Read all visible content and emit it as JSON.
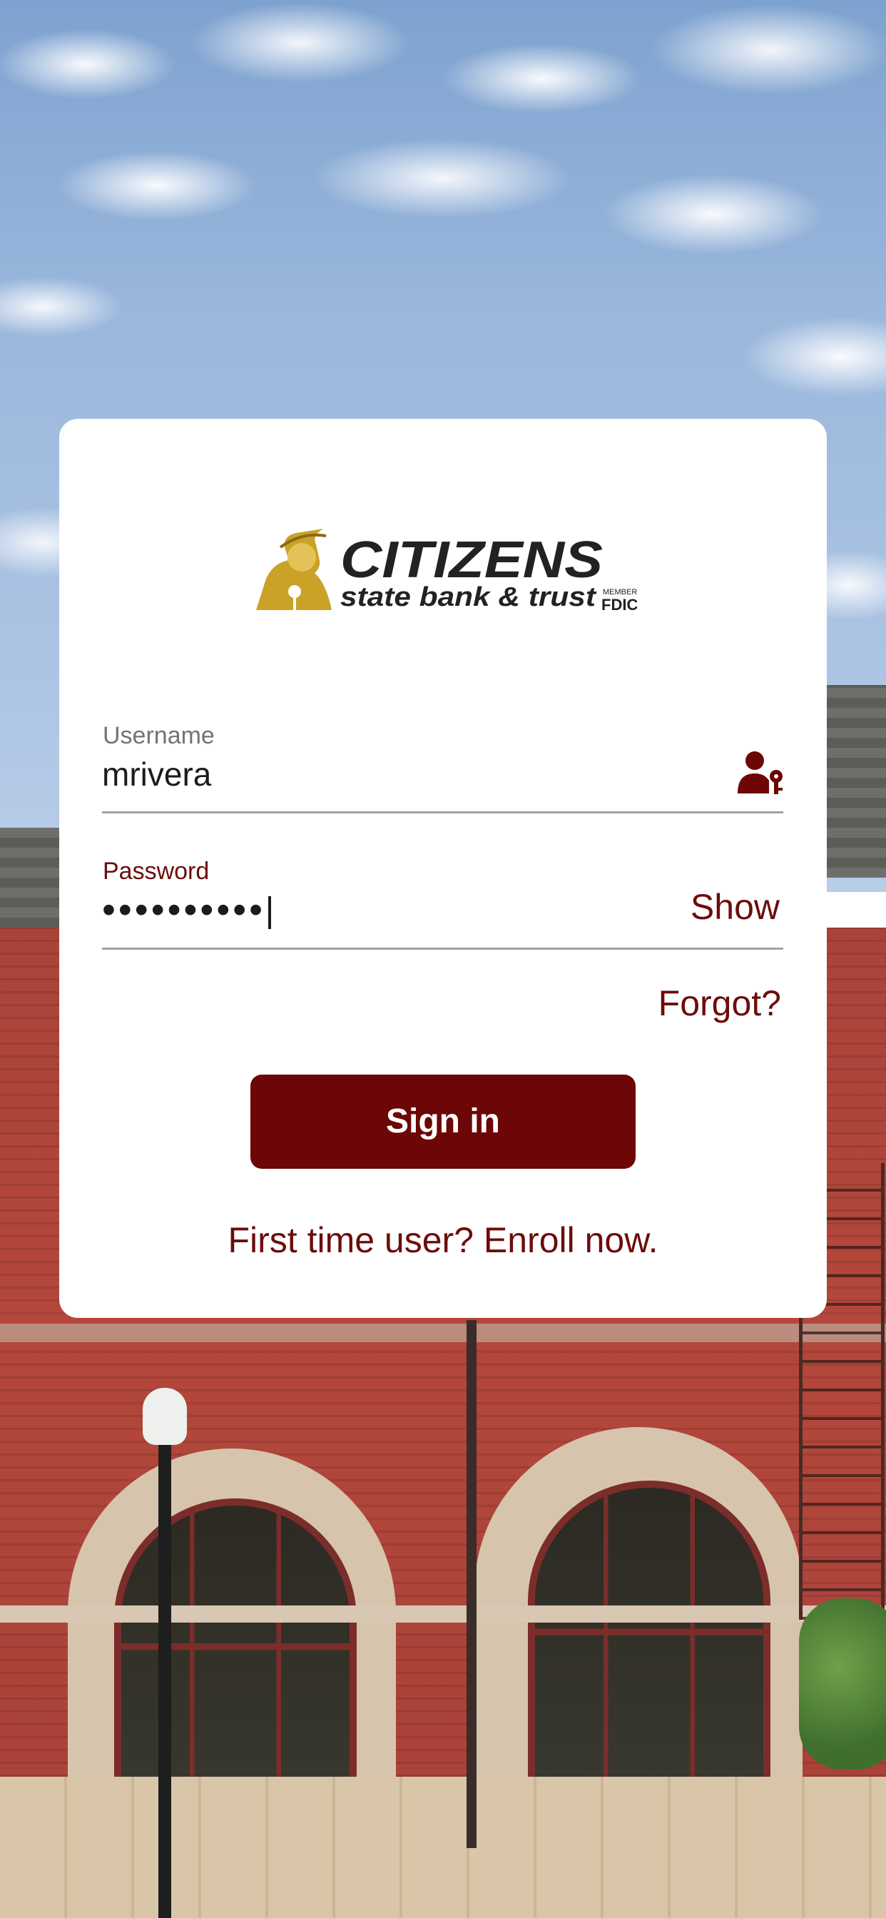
{
  "brand": {
    "name": "CITIZENS",
    "tagline": "state bank & trust",
    "member": "MEMBER",
    "fdic": "FDIC",
    "colors": {
      "primary": "#6d0606",
      "gold": "#c9a227",
      "text_dark": "#1c1c1c"
    }
  },
  "form": {
    "username": {
      "label": "Username",
      "value": "mrivera",
      "icon": "user-key-icon"
    },
    "password": {
      "label": "Password",
      "masked_value": "••••••••••",
      "show_label": "Show"
    },
    "forgot_label": "Forgot?",
    "sign_in_label": "Sign in",
    "enroll_label": "First time user? Enroll now."
  }
}
